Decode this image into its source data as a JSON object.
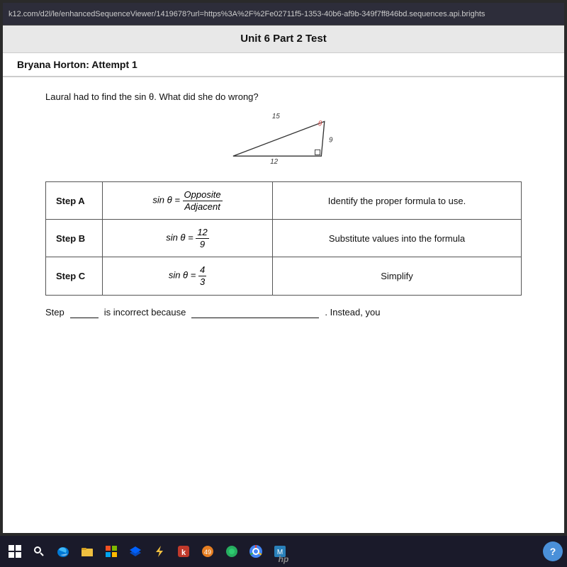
{
  "browser": {
    "url": "k12.com/d2l/le/enhancedSequenceViewer/1419678?url=https%3A%2F%2Fe02711f5-1353-40b6-af9b-349f7ff846bd.sequences.api.brights"
  },
  "header": {
    "title": "Unit 6 Part 2 Test"
  },
  "student": {
    "name": "Bryana Horton: Attempt 1"
  },
  "question": {
    "text": "Laural had to find the sin θ. What did she do wrong?"
  },
  "triangle": {
    "side_top": "15",
    "side_bottom": "12",
    "side_right": "9",
    "angle_label": "θ"
  },
  "steps": [
    {
      "label": "Step A",
      "formula_prefix": "sin θ =",
      "formula_numerator": "Opposite",
      "formula_denominator": "Adjacent",
      "description": "Identify the proper formula to use."
    },
    {
      "label": "Step B",
      "formula_prefix": "sin θ =",
      "formula_numerator": "12",
      "formula_denominator": "9",
      "description": "Substitute values into the formula"
    },
    {
      "label": "Step C",
      "formula_prefix": "sin θ =",
      "formula_numerator": "4",
      "formula_denominator": "3",
      "description": "Simplify"
    }
  ],
  "answer_prompt": {
    "prefix": "Step",
    "blank_step": "",
    "middle": "is incorrect because",
    "blank_reason": "",
    "suffix": ". Instead, you"
  },
  "taskbar": {
    "icons": [
      "⊞",
      "⊟",
      "🌐",
      "📁",
      "🪟",
      "📦",
      "⚡",
      "💻",
      "🔄",
      "🟡",
      "❓"
    ],
    "notification_count": "49",
    "hp_label": "hp"
  }
}
